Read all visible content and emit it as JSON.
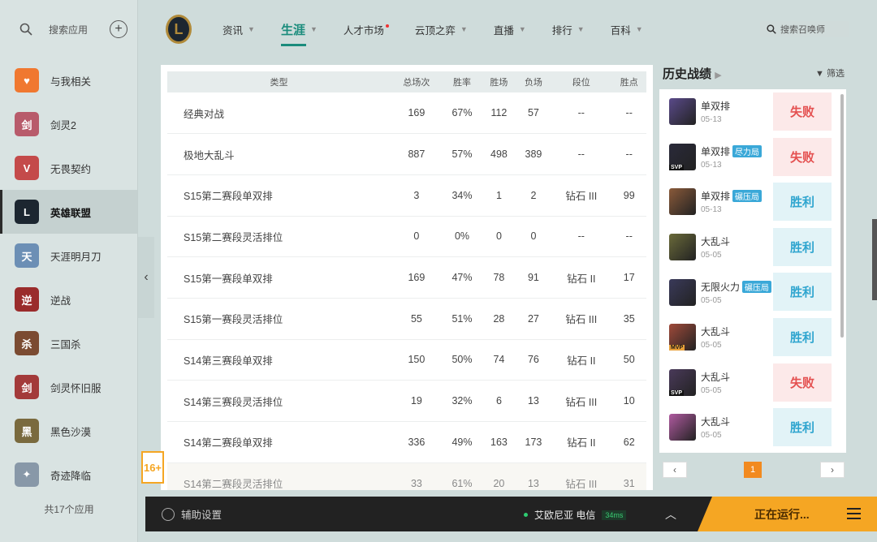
{
  "sidebar": {
    "search_label": "搜索应用",
    "apps": [
      {
        "label": "与我相关",
        "color": "#f07830",
        "glyph": "♥"
      },
      {
        "label": "剑灵2",
        "color": "#b85b6b",
        "glyph": "剑"
      },
      {
        "label": "无畏契约",
        "color": "#c44a4a",
        "glyph": "V"
      },
      {
        "label": "英雄联盟",
        "color": "#1c2630",
        "glyph": "L"
      },
      {
        "label": "天涯明月刀",
        "color": "#6c8fb5",
        "glyph": "天"
      },
      {
        "label": "逆战",
        "color": "#9a2c2c",
        "glyph": "逆"
      },
      {
        "label": "三国杀",
        "color": "#7b4b32",
        "glyph": "杀"
      },
      {
        "label": "剑灵怀旧服",
        "color": "#a33a3a",
        "glyph": "剑"
      },
      {
        "label": "黑色沙漠",
        "color": "#7a6a3e",
        "glyph": "黑"
      },
      {
        "label": "奇迹降临",
        "color": "#8898a8",
        "glyph": "✦"
      }
    ],
    "count": "共17个应用"
  },
  "topnav": {
    "items": [
      "资讯",
      "生涯",
      "人才市场",
      "云顶之弈",
      "直播",
      "排行",
      "百科"
    ],
    "search_placeholder": "搜索召唤师"
  },
  "table": {
    "headers": [
      "类型",
      "总场次",
      "胜率",
      "胜场",
      "负场",
      "段位",
      "胜点"
    ],
    "rows": [
      [
        "经典对战",
        "169",
        "67%",
        "112",
        "57",
        "--",
        "--"
      ],
      [
        "极地大乱斗",
        "887",
        "57%",
        "498",
        "389",
        "--",
        "--"
      ],
      [
        "S15第二赛段单双排",
        "3",
        "34%",
        "1",
        "2",
        "钻石 III",
        "99"
      ],
      [
        "S15第二赛段灵活排位",
        "0",
        "0%",
        "0",
        "0",
        "--",
        "--"
      ],
      [
        "S15第一赛段单双排",
        "169",
        "47%",
        "78",
        "91",
        "钻石 II",
        "17"
      ],
      [
        "S15第一赛段灵活排位",
        "55",
        "51%",
        "28",
        "27",
        "钻石 III",
        "35"
      ],
      [
        "S14第三赛段单双排",
        "150",
        "50%",
        "74",
        "76",
        "钻石 II",
        "50"
      ],
      [
        "S14第三赛段灵活排位",
        "19",
        "32%",
        "6",
        "13",
        "钻石 III",
        "10"
      ],
      [
        "S14第二赛段单双排",
        "336",
        "49%",
        "163",
        "173",
        "钻石 II",
        "62"
      ],
      [
        "S14第二赛段灵活排位",
        "33",
        "61%",
        "20",
        "13",
        "钻石 III",
        "31"
      ]
    ]
  },
  "history": {
    "title": "历史战绩",
    "filter": "筛选",
    "matches": [
      {
        "mode": "单双排",
        "tag": "",
        "date": "05-13",
        "result": "失败",
        "win": false,
        "badge": "",
        "color": "#5a4a8a"
      },
      {
        "mode": "单双排",
        "tag": "尽力局",
        "date": "05-13",
        "result": "失败",
        "win": false,
        "badge": "SVP",
        "color": "#2a2a3a"
      },
      {
        "mode": "单双排",
        "tag": "碾压局",
        "date": "05-13",
        "result": "胜利",
        "win": true,
        "badge": "",
        "color": "#8a5a3a"
      },
      {
        "mode": "大乱斗",
        "tag": "",
        "date": "05-05",
        "result": "胜利",
        "win": true,
        "badge": "",
        "color": "#6a6a3a"
      },
      {
        "mode": "无限火力",
        "tag": "碾压局",
        "date": "05-05",
        "result": "胜利",
        "win": true,
        "badge": "",
        "color": "#3a3a5a"
      },
      {
        "mode": "大乱斗",
        "tag": "",
        "date": "05-05",
        "result": "胜利",
        "win": true,
        "badge": "MVP",
        "color": "#a04a3a"
      },
      {
        "mode": "大乱斗",
        "tag": "",
        "date": "05-05",
        "result": "失败",
        "win": false,
        "badge": "SVP",
        "color": "#4a3a5a"
      },
      {
        "mode": "大乱斗",
        "tag": "",
        "date": "05-05",
        "result": "胜利",
        "win": true,
        "badge": "",
        "color": "#b05aa0"
      }
    ],
    "page": "1"
  },
  "age_rating": {
    "value": "16+"
  },
  "bottombar": {
    "assist": "辅助设置",
    "server": "艾欧尼亚 电信",
    "ping": "34ms",
    "running": "正在运行..."
  }
}
